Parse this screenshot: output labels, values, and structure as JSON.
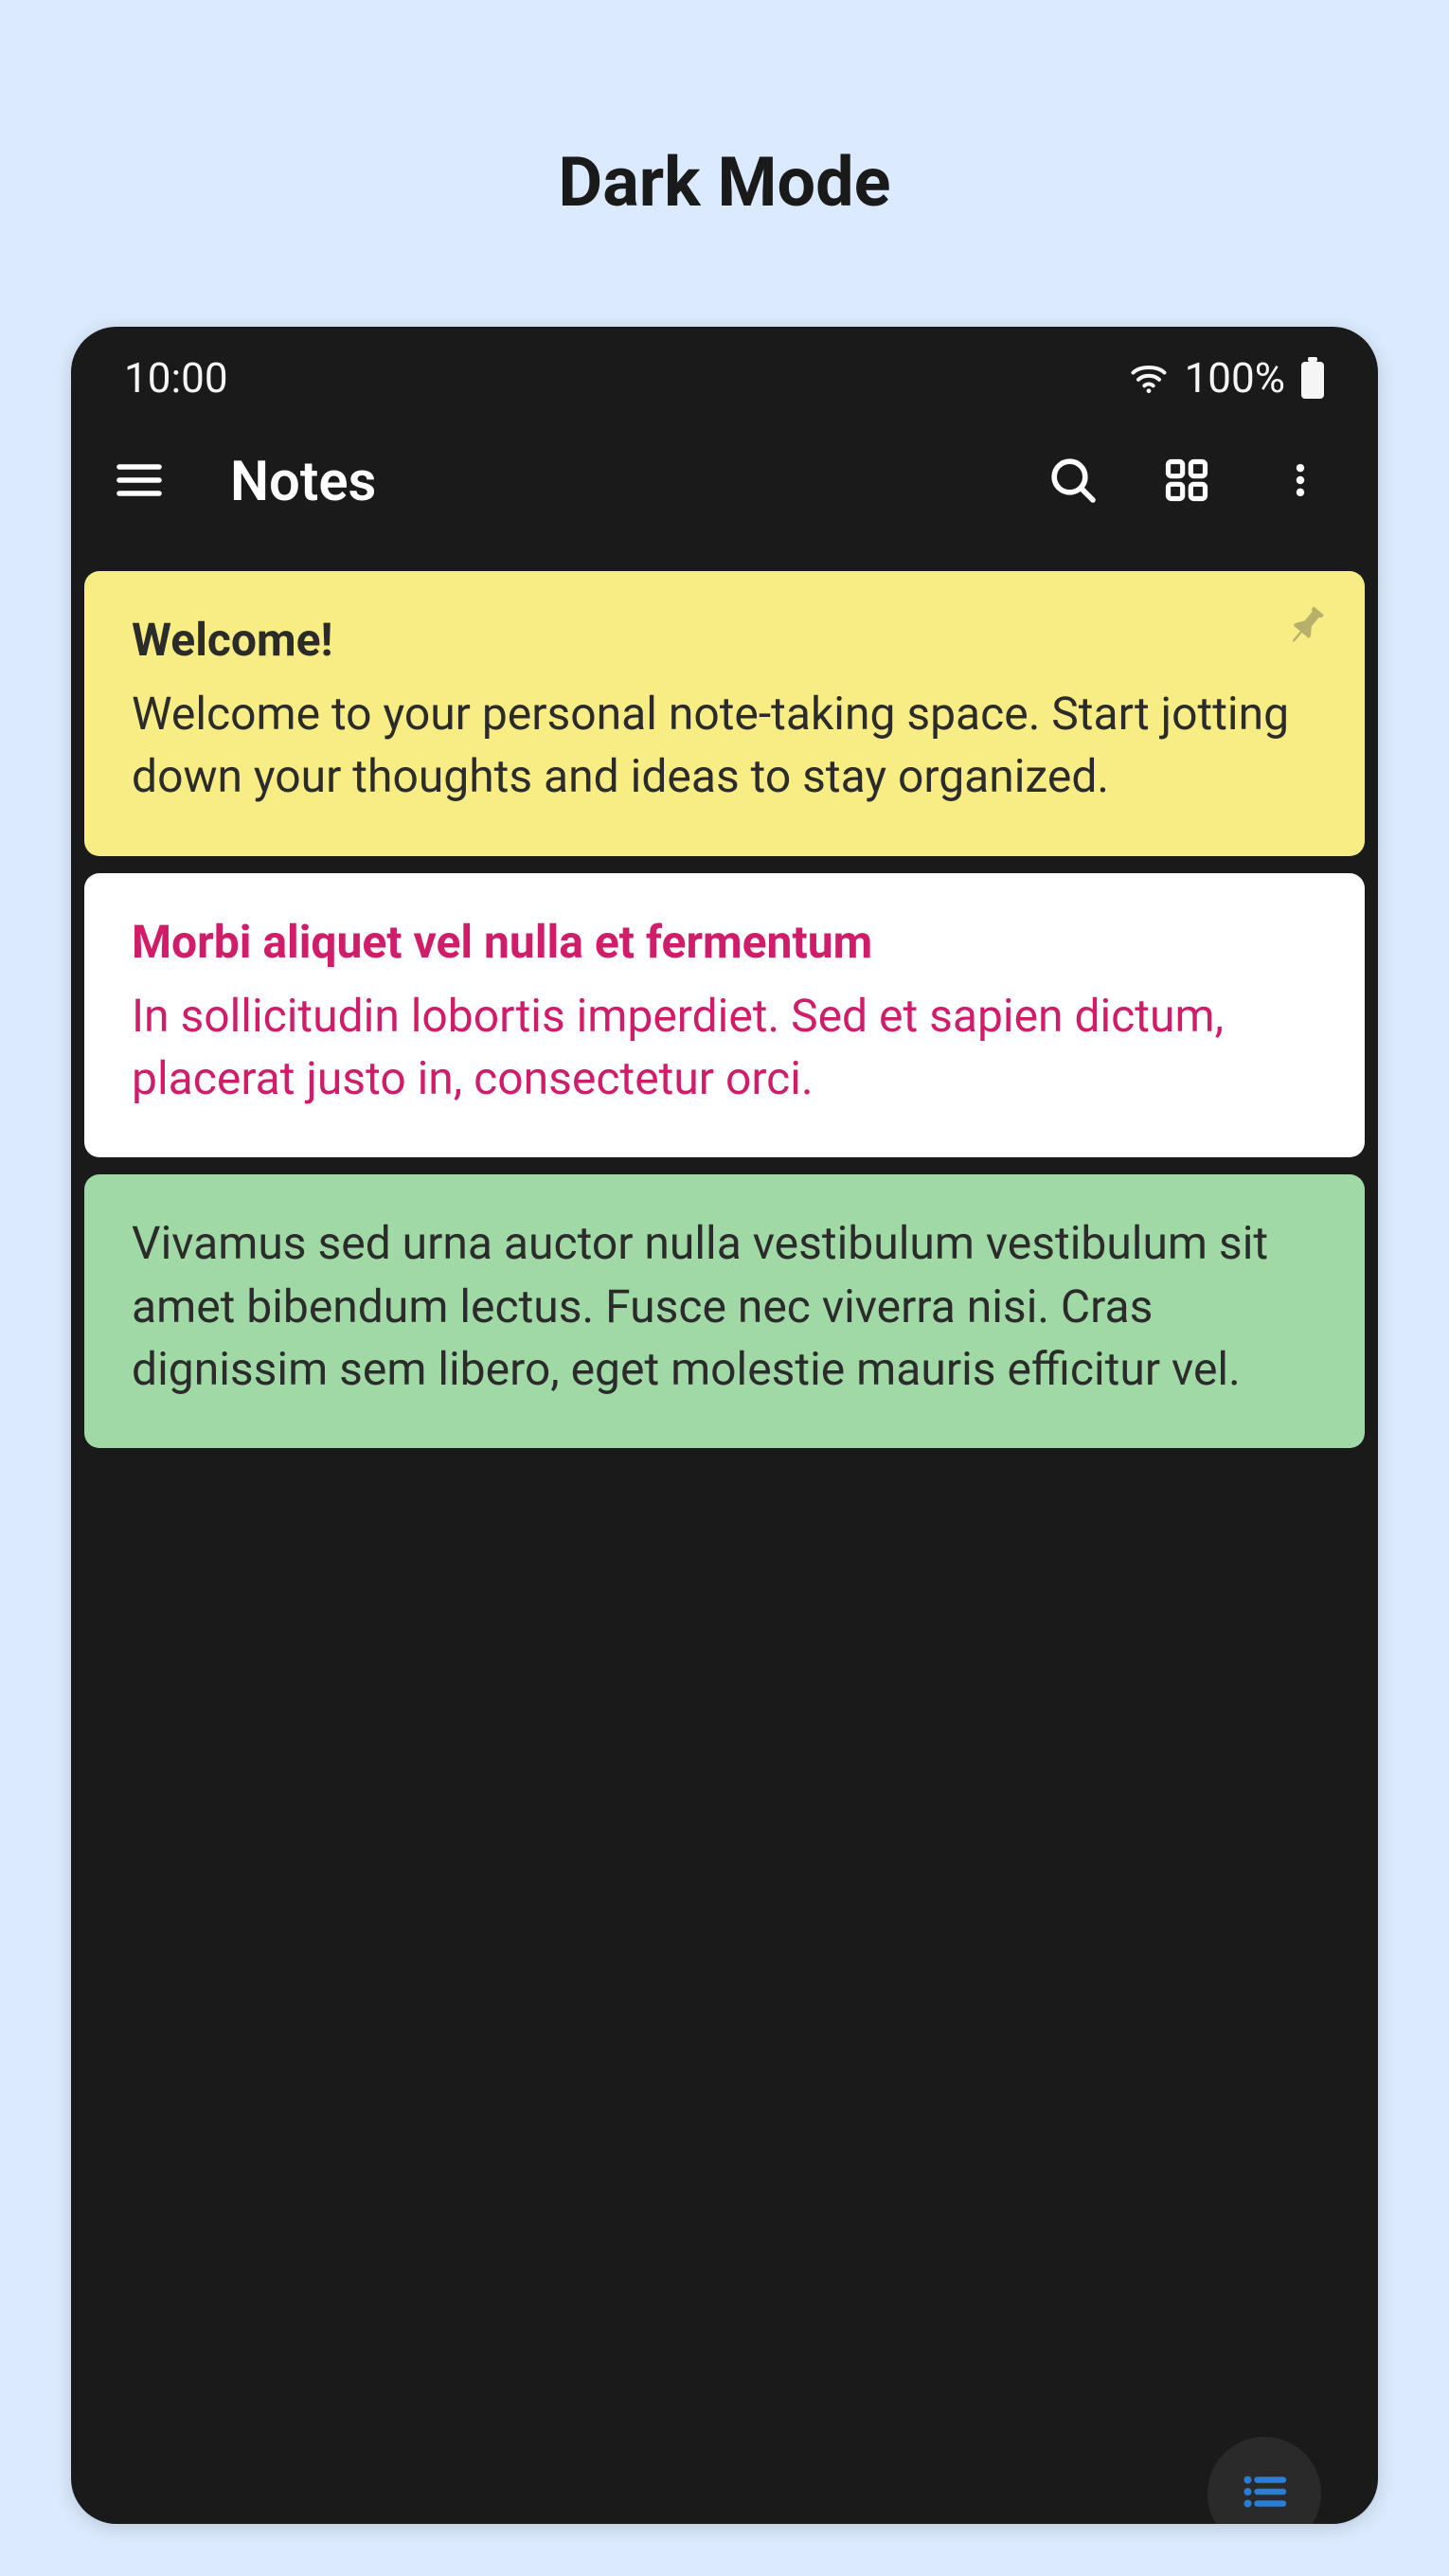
{
  "page": {
    "heading": "Dark Mode"
  },
  "status": {
    "time": "10:00",
    "battery": "100%"
  },
  "appbar": {
    "title": "Notes"
  },
  "notes": [
    {
      "title": "Welcome!",
      "body": "Welcome to your personal note-taking space. Start jotting down your thoughts and ideas to stay organized.",
      "pinned": true,
      "color": "yellow"
    },
    {
      "title": "Morbi aliquet vel nulla et fermentum",
      "body": "In sollicitudin lobortis imperdiet. Sed et sapien dictum, placerat justo in, consectetur orci.",
      "pinned": false,
      "color": "white"
    },
    {
      "title": "",
      "body": "Vivamus sed urna auctor nulla vestibulum vestibulum sit amet bibendum lectus. Fusce nec viverra nisi. Cras dignissim sem libero, eget molestie mauris efficitur vel.",
      "pinned": false,
      "color": "green"
    }
  ]
}
